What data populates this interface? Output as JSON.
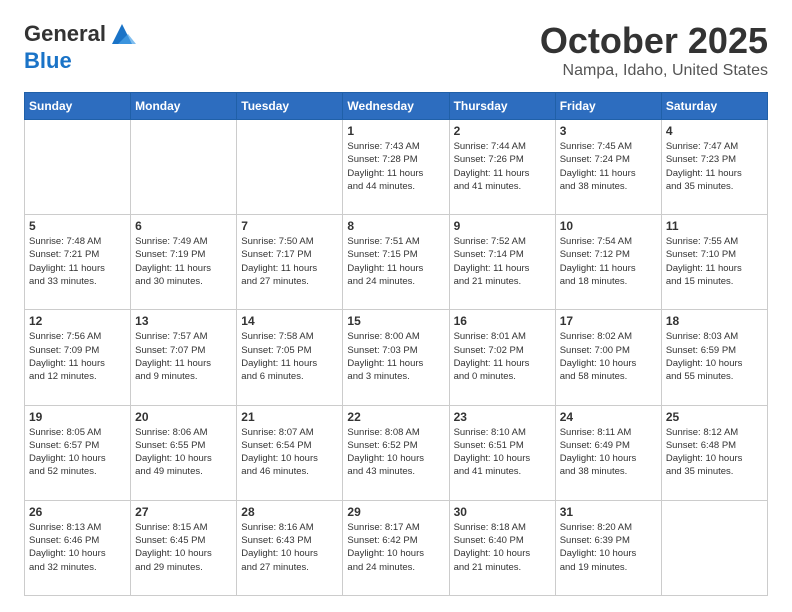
{
  "header": {
    "logo": {
      "general": "General",
      "blue": "Blue"
    },
    "title": "October 2025",
    "location": "Nampa, Idaho, United States"
  },
  "weekdays": [
    "Sunday",
    "Monday",
    "Tuesday",
    "Wednesday",
    "Thursday",
    "Friday",
    "Saturday"
  ],
  "weeks": [
    {
      "days": [
        {
          "number": "",
          "info": ""
        },
        {
          "number": "",
          "info": ""
        },
        {
          "number": "",
          "info": ""
        },
        {
          "number": "1",
          "info": "Sunrise: 7:43 AM\nSunset: 7:28 PM\nDaylight: 11 hours\nand 44 minutes."
        },
        {
          "number": "2",
          "info": "Sunrise: 7:44 AM\nSunset: 7:26 PM\nDaylight: 11 hours\nand 41 minutes."
        },
        {
          "number": "3",
          "info": "Sunrise: 7:45 AM\nSunset: 7:24 PM\nDaylight: 11 hours\nand 38 minutes."
        },
        {
          "number": "4",
          "info": "Sunrise: 7:47 AM\nSunset: 7:23 PM\nDaylight: 11 hours\nand 35 minutes."
        }
      ]
    },
    {
      "days": [
        {
          "number": "5",
          "info": "Sunrise: 7:48 AM\nSunset: 7:21 PM\nDaylight: 11 hours\nand 33 minutes."
        },
        {
          "number": "6",
          "info": "Sunrise: 7:49 AM\nSunset: 7:19 PM\nDaylight: 11 hours\nand 30 minutes."
        },
        {
          "number": "7",
          "info": "Sunrise: 7:50 AM\nSunset: 7:17 PM\nDaylight: 11 hours\nand 27 minutes."
        },
        {
          "number": "8",
          "info": "Sunrise: 7:51 AM\nSunset: 7:15 PM\nDaylight: 11 hours\nand 24 minutes."
        },
        {
          "number": "9",
          "info": "Sunrise: 7:52 AM\nSunset: 7:14 PM\nDaylight: 11 hours\nand 21 minutes."
        },
        {
          "number": "10",
          "info": "Sunrise: 7:54 AM\nSunset: 7:12 PM\nDaylight: 11 hours\nand 18 minutes."
        },
        {
          "number": "11",
          "info": "Sunrise: 7:55 AM\nSunset: 7:10 PM\nDaylight: 11 hours\nand 15 minutes."
        }
      ]
    },
    {
      "days": [
        {
          "number": "12",
          "info": "Sunrise: 7:56 AM\nSunset: 7:09 PM\nDaylight: 11 hours\nand 12 minutes."
        },
        {
          "number": "13",
          "info": "Sunrise: 7:57 AM\nSunset: 7:07 PM\nDaylight: 11 hours\nand 9 minutes."
        },
        {
          "number": "14",
          "info": "Sunrise: 7:58 AM\nSunset: 7:05 PM\nDaylight: 11 hours\nand 6 minutes."
        },
        {
          "number": "15",
          "info": "Sunrise: 8:00 AM\nSunset: 7:03 PM\nDaylight: 11 hours\nand 3 minutes."
        },
        {
          "number": "16",
          "info": "Sunrise: 8:01 AM\nSunset: 7:02 PM\nDaylight: 11 hours\nand 0 minutes."
        },
        {
          "number": "17",
          "info": "Sunrise: 8:02 AM\nSunset: 7:00 PM\nDaylight: 10 hours\nand 58 minutes."
        },
        {
          "number": "18",
          "info": "Sunrise: 8:03 AM\nSunset: 6:59 PM\nDaylight: 10 hours\nand 55 minutes."
        }
      ]
    },
    {
      "days": [
        {
          "number": "19",
          "info": "Sunrise: 8:05 AM\nSunset: 6:57 PM\nDaylight: 10 hours\nand 52 minutes."
        },
        {
          "number": "20",
          "info": "Sunrise: 8:06 AM\nSunset: 6:55 PM\nDaylight: 10 hours\nand 49 minutes."
        },
        {
          "number": "21",
          "info": "Sunrise: 8:07 AM\nSunset: 6:54 PM\nDaylight: 10 hours\nand 46 minutes."
        },
        {
          "number": "22",
          "info": "Sunrise: 8:08 AM\nSunset: 6:52 PM\nDaylight: 10 hours\nand 43 minutes."
        },
        {
          "number": "23",
          "info": "Sunrise: 8:10 AM\nSunset: 6:51 PM\nDaylight: 10 hours\nand 41 minutes."
        },
        {
          "number": "24",
          "info": "Sunrise: 8:11 AM\nSunset: 6:49 PM\nDaylight: 10 hours\nand 38 minutes."
        },
        {
          "number": "25",
          "info": "Sunrise: 8:12 AM\nSunset: 6:48 PM\nDaylight: 10 hours\nand 35 minutes."
        }
      ]
    },
    {
      "days": [
        {
          "number": "26",
          "info": "Sunrise: 8:13 AM\nSunset: 6:46 PM\nDaylight: 10 hours\nand 32 minutes."
        },
        {
          "number": "27",
          "info": "Sunrise: 8:15 AM\nSunset: 6:45 PM\nDaylight: 10 hours\nand 29 minutes."
        },
        {
          "number": "28",
          "info": "Sunrise: 8:16 AM\nSunset: 6:43 PM\nDaylight: 10 hours\nand 27 minutes."
        },
        {
          "number": "29",
          "info": "Sunrise: 8:17 AM\nSunset: 6:42 PM\nDaylight: 10 hours\nand 24 minutes."
        },
        {
          "number": "30",
          "info": "Sunrise: 8:18 AM\nSunset: 6:40 PM\nDaylight: 10 hours\nand 21 minutes."
        },
        {
          "number": "31",
          "info": "Sunrise: 8:20 AM\nSunset: 6:39 PM\nDaylight: 10 hours\nand 19 minutes."
        },
        {
          "number": "",
          "info": ""
        }
      ]
    }
  ]
}
